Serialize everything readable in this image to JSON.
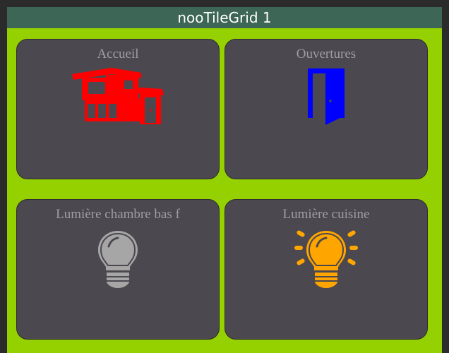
{
  "window": {
    "title": "nooTileGrid 1"
  },
  "tiles": [
    {
      "label": "Accueil",
      "icon": "house-icon",
      "icon_color": "#ff0000"
    },
    {
      "label": "Ouvertures",
      "icon": "door-icon",
      "icon_color": "#0000ff"
    },
    {
      "label": "Lumière chambre bas f",
      "icon": "lightbulb-off-icon",
      "icon_color": "#a6a6a6"
    },
    {
      "label": "Lumière cuisine",
      "icon": "lightbulb-on-icon",
      "icon_color": "#ffa500"
    }
  ],
  "colors": {
    "background": "#95d100",
    "titlebar": "#3d6656",
    "tile": "#4b484f",
    "label": "#9e9ea3"
  }
}
